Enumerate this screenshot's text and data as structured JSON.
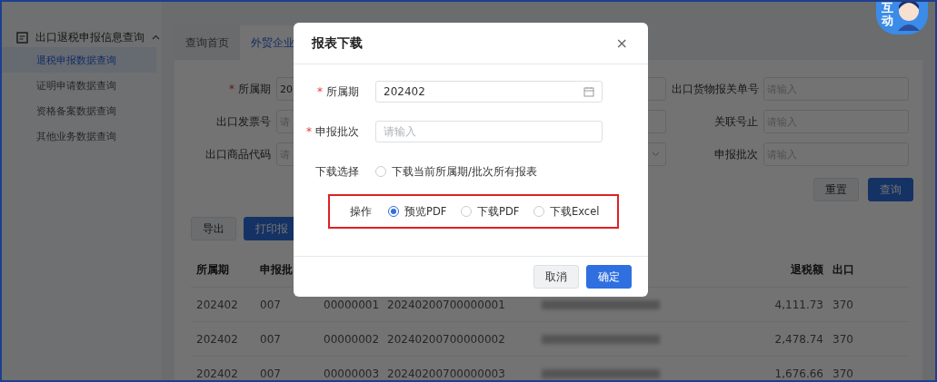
{
  "sidebar": {
    "menu": {
      "label": "出口退税申报信息查询",
      "expanded": true,
      "children": [
        {
          "label": "退税申报数据查询",
          "selected": true
        },
        {
          "label": "证明申请数据查询",
          "selected": false
        },
        {
          "label": "资格备案数据查询",
          "selected": false
        },
        {
          "label": "其他业务数据查询",
          "selected": false
        }
      ]
    }
  },
  "tabs": [
    {
      "label": "查询首页",
      "selected": false
    },
    {
      "label": "外贸企业",
      "selected": true
    }
  ],
  "filters_left": [
    {
      "label": "所属期",
      "required_mark": "*",
      "value": "20"
    },
    {
      "label": "出口发票号",
      "placeholder": "请"
    },
    {
      "label": "出口商品代码",
      "placeholder": "请"
    }
  ],
  "filters_right": [
    {
      "label": "出口货物报关单号",
      "placeholder": "请输入"
    },
    {
      "label": "关联号止",
      "placeholder": "请输入"
    },
    {
      "label": "申报批次",
      "placeholder": "请输入"
    }
  ],
  "filter_buttons": [
    {
      "label": "重置",
      "primary": false
    },
    {
      "label": "查询",
      "primary": true
    }
  ],
  "actions": [
    {
      "label": "导出",
      "primary": false
    },
    {
      "label": "打印报",
      "primary": true
    }
  ],
  "table": {
    "columns": {
      "column_1": "所属期",
      "column_2": "申报批",
      "column_6": "退税额",
      "column_7": "出口"
    },
    "rows": [
      {
        "cells": [
          "202402",
          "007",
          "00000001",
          "20240200700000001"
        ],
        "amount": "4,111.73",
        "column_7": "370"
      },
      {
        "cells": [
          "202402",
          "007",
          "00000002",
          "20240200700000002"
        ],
        "amount": "2,478.74",
        "column_7": "370"
      },
      {
        "cells": [
          "202402",
          "007",
          "00000003",
          "20240200700000003"
        ],
        "amount": "1,676.66",
        "column_7": "370"
      }
    ]
  },
  "badge": {
    "label": "互动"
  },
  "dialog": {
    "title": "报表下载",
    "close": "×",
    "fields": [
      {
        "kind": "date",
        "label": "所属期",
        "required_mark": "*",
        "value": "202402"
      },
      {
        "kind": "text",
        "label": "申报批次",
        "required_mark": "*",
        "placeholder": "请输入"
      },
      {
        "kind": "radio",
        "label": "下载选择",
        "highlighted": false,
        "options": [
          {
            "label": "下载当前所属期/批次所有报表",
            "selected": false
          }
        ]
      },
      {
        "kind": "radio",
        "label": "操作",
        "highlighted": true,
        "options": [
          {
            "label": "预览PDF",
            "selected": true
          },
          {
            "label": "下载PDF",
            "selected": false
          },
          {
            "label": "下载Excel",
            "selected": false
          }
        ]
      }
    ],
    "buttons": [
      {
        "label": "取消",
        "primary": false
      },
      {
        "label": "确定",
        "primary": true
      }
    ]
  }
}
